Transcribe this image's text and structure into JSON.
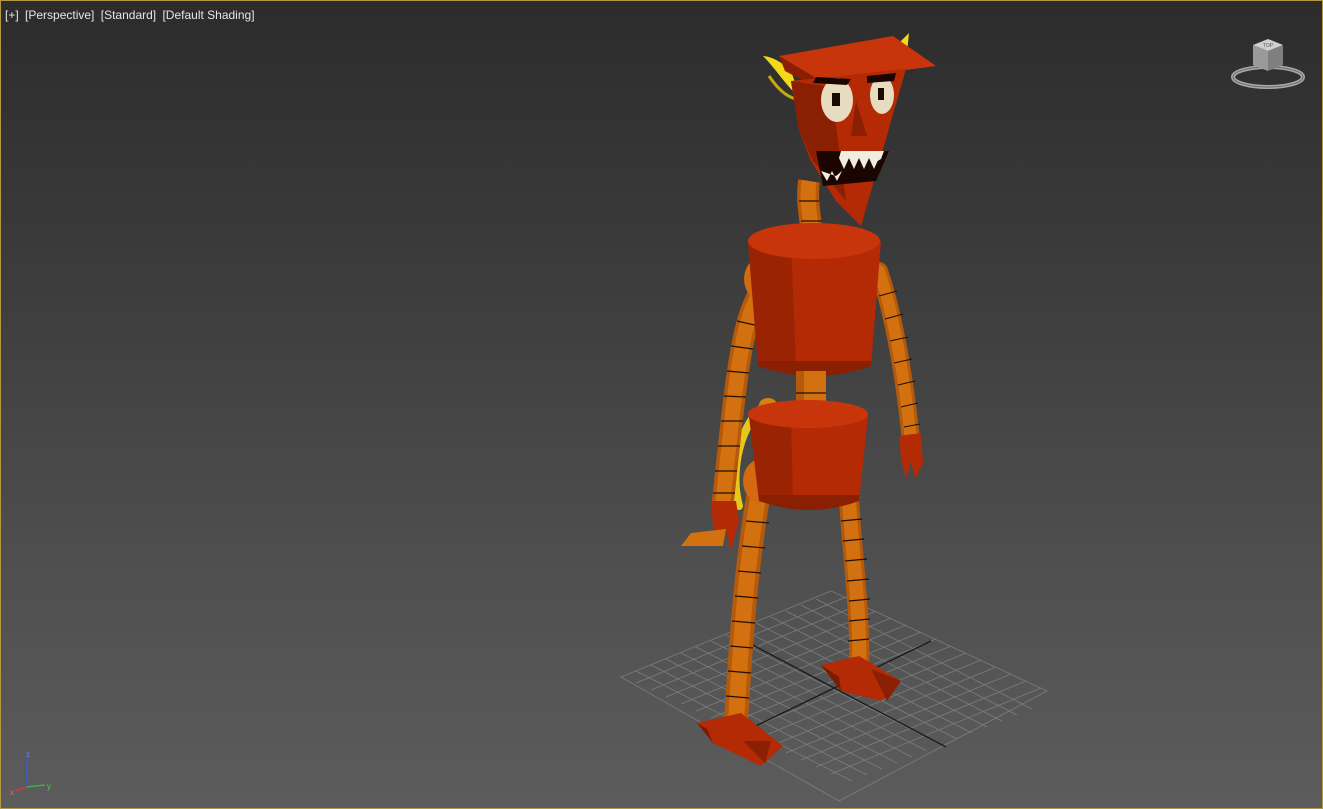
{
  "viewport": {
    "labels": [
      "[+]",
      "[Perspective]",
      "[Standard]",
      "[Default Shading]"
    ],
    "border_color": "#b39a3e",
    "background_top": "#2c2c2c",
    "background_bottom": "#5c5c5c"
  },
  "viewcube": {
    "icon": "viewcube-icon",
    "face_text": "TOP"
  },
  "axis_gizmo": {
    "x_label": "x",
    "y_label": "y",
    "z_label": "z"
  },
  "scene": {
    "object": "devil-robot-model",
    "colors": {
      "body": "#b32a05",
      "limb": "#cf6a10",
      "horn": "#f2d91a",
      "eye": "#e8dcc0",
      "grid": "#9a9a9a"
    }
  }
}
